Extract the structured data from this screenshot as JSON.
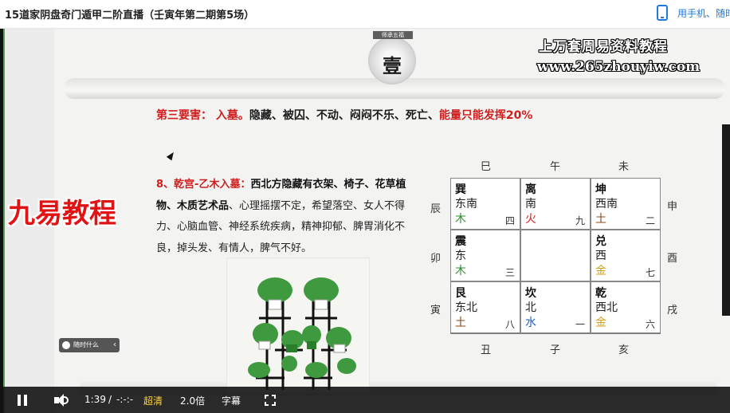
{
  "page": {
    "title": "15道家阴盘奇门遁甲二阶直播（壬寅年第二期第5场）",
    "mobile_link": "用手机、随时"
  },
  "slide": {
    "seal_caption": "师承五福",
    "seal_text": "壹",
    "watermark_line1": "上万套周易资料教程",
    "watermark_line2": "www.265zhouyiw.com",
    "brand_logo": "九易教程",
    "heading": {
      "part1": "第三要害：",
      "part2": "入墓。",
      "part3": "隐藏、被囚、不动、闷闷不乐、死亡、",
      "part4": "能量只能发挥20%"
    },
    "paragraph": {
      "lead": "8、乾宫-乙木入墓：",
      "bold": "西北方隐藏有衣架、椅子、花草植物、木质艺术品",
      "rest": "、心理摇摆不定，希望落空、女人不得力、心脑血管、神经系统疾病，精神抑郁、脾胃消化不良，掉头发、有情人，脾气不好。"
    },
    "branches_top": [
      "巳",
      "午",
      "未"
    ],
    "branches_left": [
      "辰",
      "卯",
      "寅"
    ],
    "branches_right": [
      "申",
      "酉",
      "戌"
    ],
    "branches_bottom": [
      "丑",
      "子",
      "亥"
    ],
    "palaces": [
      {
        "name": "巽",
        "direction": "东南",
        "element": "木",
        "element_color": "#2e8b2e",
        "number": "四"
      },
      {
        "name": "离",
        "direction": "南",
        "element": "火",
        "element_color": "#d22222",
        "number": "九"
      },
      {
        "name": "坤",
        "direction": "西南",
        "element": "土",
        "element_color": "#8b4513",
        "number": "二"
      },
      {
        "name": "震",
        "direction": "东",
        "element": "木",
        "element_color": "#2e8b2e",
        "number": "三"
      },
      {
        "name": "",
        "direction": "",
        "element": "",
        "element_color": "#000000",
        "number": ""
      },
      {
        "name": "兑",
        "direction": "西",
        "element": "金",
        "element_color": "#d4a017",
        "number": "七"
      },
      {
        "name": "艮",
        "direction": "东北",
        "element": "土",
        "element_color": "#8b4513",
        "number": "八"
      },
      {
        "name": "坎",
        "direction": "北",
        "element": "水",
        "element_color": "#1f5fbf",
        "number": "一"
      },
      {
        "name": "乾",
        "direction": "西北",
        "element": "金",
        "element_color": "#d4a017",
        "number": "六"
      }
    ],
    "tooltip": "随时什么"
  },
  "player": {
    "time_current": "1:39",
    "time_sep": "/",
    "time_total": "-:-:-",
    "quality": "超清",
    "speed": "2.0倍",
    "subtitle": "字幕"
  }
}
